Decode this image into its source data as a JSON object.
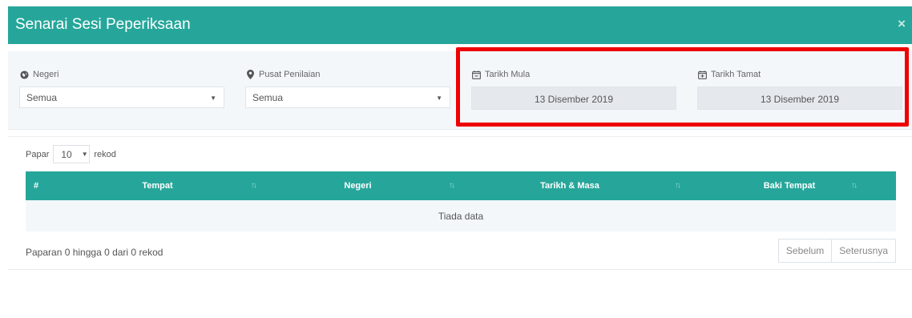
{
  "modal": {
    "title": "Senarai Sesi Peperiksaan",
    "close_glyph": "×"
  },
  "filters": {
    "negeri": {
      "label": "Negeri",
      "value": "Semua",
      "icon": "globe-icon"
    },
    "pusat": {
      "label": "Pusat Penilaian",
      "value": "Semua",
      "icon": "map-marker-icon"
    },
    "tarikh_mula": {
      "label": "Tarikh Mula",
      "value": "13 Disember 2019",
      "icon": "calendar-minus-icon"
    },
    "tarikh_tamat": {
      "label": "Tarikh Tamat",
      "value": "13 Disember 2019",
      "icon": "calendar-plus-icon"
    }
  },
  "table_controls": {
    "show_prefix": "Papar",
    "page_length": "10",
    "show_suffix": "rekod"
  },
  "table": {
    "columns": [
      "#",
      "Tempat",
      "Negeri",
      "Tarikh & Masa",
      "Baki Tempat"
    ],
    "sorted_column": "Tarikh & Masa",
    "empty_message": "Tiada data"
  },
  "footer": {
    "info": "Paparan 0 hingga 0 dari 0 rekod",
    "prev_label": "Sebelum",
    "next_label": "Seterusnya"
  },
  "colors": {
    "header_teal": "#26a69a",
    "panel_bg": "#f3f7fa",
    "highlight_red": "#ee0000"
  }
}
